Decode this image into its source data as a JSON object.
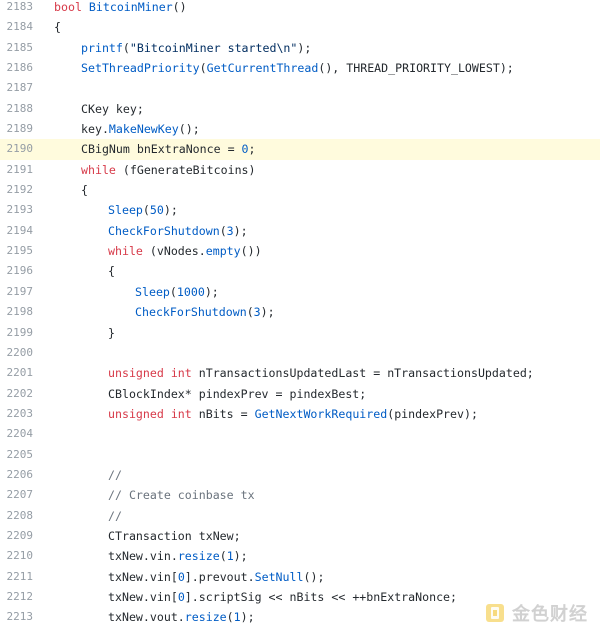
{
  "code_view": {
    "highlight_line": "2190",
    "lines": [
      {
        "no": "2183",
        "indent": 0,
        "tokens": [
          [
            "kw",
            "bool "
          ],
          [
            "fn",
            "BitcoinMiner"
          ],
          [
            "pl",
            "()"
          ]
        ]
      },
      {
        "no": "2184",
        "indent": 0,
        "tokens": [
          [
            "pl",
            "{"
          ]
        ]
      },
      {
        "no": "2185",
        "indent": 1,
        "tokens": [
          [
            "fn",
            "printf"
          ],
          [
            "pl",
            "("
          ],
          [
            "str",
            "\"BitcoinMiner started\\n\""
          ],
          [
            "pl",
            ");"
          ]
        ]
      },
      {
        "no": "2186",
        "indent": 1,
        "tokens": [
          [
            "fn",
            "SetThreadPriority"
          ],
          [
            "pl",
            "("
          ],
          [
            "fn",
            "GetCurrentThread"
          ],
          [
            "pl",
            "(), THREAD_PRIORITY_LOWEST);"
          ]
        ]
      },
      {
        "no": "2187",
        "indent": 0,
        "tokens": []
      },
      {
        "no": "2188",
        "indent": 1,
        "tokens": [
          [
            "pl",
            "CKey key;"
          ]
        ]
      },
      {
        "no": "2189",
        "indent": 1,
        "tokens": [
          [
            "pl",
            "key."
          ],
          [
            "fn",
            "MakeNewKey"
          ],
          [
            "pl",
            "();"
          ]
        ]
      },
      {
        "no": "2190",
        "indent": 1,
        "tokens": [
          [
            "pl",
            "CBigNum bnExtraNonce = "
          ],
          [
            "num",
            "0"
          ],
          [
            "pl",
            ";"
          ]
        ]
      },
      {
        "no": "2191",
        "indent": 1,
        "tokens": [
          [
            "kw",
            "while"
          ],
          [
            "pl",
            " (fGenerateBitcoins)"
          ]
        ]
      },
      {
        "no": "2192",
        "indent": 1,
        "tokens": [
          [
            "pl",
            "{"
          ]
        ]
      },
      {
        "no": "2193",
        "indent": 2,
        "tokens": [
          [
            "fn",
            "Sleep"
          ],
          [
            "pl",
            "("
          ],
          [
            "num",
            "50"
          ],
          [
            "pl",
            ");"
          ]
        ]
      },
      {
        "no": "2194",
        "indent": 2,
        "tokens": [
          [
            "fn",
            "CheckForShutdown"
          ],
          [
            "pl",
            "("
          ],
          [
            "num",
            "3"
          ],
          [
            "pl",
            ");"
          ]
        ]
      },
      {
        "no": "2195",
        "indent": 2,
        "tokens": [
          [
            "kw",
            "while"
          ],
          [
            "pl",
            " (vNodes."
          ],
          [
            "fn",
            "empty"
          ],
          [
            "pl",
            "())"
          ]
        ]
      },
      {
        "no": "2196",
        "indent": 2,
        "tokens": [
          [
            "pl",
            "{"
          ]
        ]
      },
      {
        "no": "2197",
        "indent": 3,
        "tokens": [
          [
            "fn",
            "Sleep"
          ],
          [
            "pl",
            "("
          ],
          [
            "num",
            "1000"
          ],
          [
            "pl",
            ");"
          ]
        ]
      },
      {
        "no": "2198",
        "indent": 3,
        "tokens": [
          [
            "fn",
            "CheckForShutdown"
          ],
          [
            "pl",
            "("
          ],
          [
            "num",
            "3"
          ],
          [
            "pl",
            ");"
          ]
        ]
      },
      {
        "no": "2199",
        "indent": 2,
        "tokens": [
          [
            "pl",
            "}"
          ]
        ]
      },
      {
        "no": "2200",
        "indent": 0,
        "tokens": []
      },
      {
        "no": "2201",
        "indent": 2,
        "tokens": [
          [
            "kw",
            "unsigned int"
          ],
          [
            "pl",
            " nTransactionsUpdatedLast = nTransactionsUpdated;"
          ]
        ]
      },
      {
        "no": "2202",
        "indent": 2,
        "tokens": [
          [
            "pl",
            "CBlockIndex* pindexPrev = pindexBest;"
          ]
        ]
      },
      {
        "no": "2203",
        "indent": 2,
        "tokens": [
          [
            "kw",
            "unsigned int"
          ],
          [
            "pl",
            " nBits = "
          ],
          [
            "fn",
            "GetNextWorkRequired"
          ],
          [
            "pl",
            "(pindexPrev);"
          ]
        ]
      },
      {
        "no": "2204",
        "indent": 0,
        "tokens": []
      },
      {
        "no": "2205",
        "indent": 0,
        "tokens": []
      },
      {
        "no": "2206",
        "indent": 2,
        "tokens": [
          [
            "cm",
            "//"
          ]
        ]
      },
      {
        "no": "2207",
        "indent": 2,
        "tokens": [
          [
            "cm",
            "// Create coinbase tx"
          ]
        ]
      },
      {
        "no": "2208",
        "indent": 2,
        "tokens": [
          [
            "cm",
            "//"
          ]
        ]
      },
      {
        "no": "2209",
        "indent": 2,
        "tokens": [
          [
            "pl",
            "CTransaction txNew;"
          ]
        ]
      },
      {
        "no": "2210",
        "indent": 2,
        "tokens": [
          [
            "pl",
            "txNew.vin."
          ],
          [
            "fn",
            "resize"
          ],
          [
            "pl",
            "("
          ],
          [
            "num",
            "1"
          ],
          [
            "pl",
            ");"
          ]
        ]
      },
      {
        "no": "2211",
        "indent": 2,
        "tokens": [
          [
            "pl",
            "txNew.vin["
          ],
          [
            "num",
            "0"
          ],
          [
            "pl",
            "].prevout."
          ],
          [
            "fn",
            "SetNull"
          ],
          [
            "pl",
            "();"
          ]
        ]
      },
      {
        "no": "2212",
        "indent": 2,
        "tokens": [
          [
            "pl",
            "txNew.vin["
          ],
          [
            "num",
            "0"
          ],
          [
            "pl",
            "].scriptSig << nBits << ++bnExtraNonce;"
          ]
        ]
      },
      {
        "no": "2213",
        "indent": 2,
        "tokens": [
          [
            "pl",
            "txNew.vout."
          ],
          [
            "fn",
            "resize"
          ],
          [
            "pl",
            "("
          ],
          [
            "num",
            "1"
          ],
          [
            "pl",
            ");"
          ]
        ]
      }
    ]
  },
  "watermark": {
    "text": "金色财经",
    "logo_color": "#f0b90b",
    "icon": "jinse-logo-icon"
  },
  "colors": {
    "keyword": "#d73a49",
    "function": "#005cc5",
    "string": "#032f62",
    "comment": "#6a737d",
    "line_number": "#959da5",
    "highlight": "#fffbdd"
  }
}
